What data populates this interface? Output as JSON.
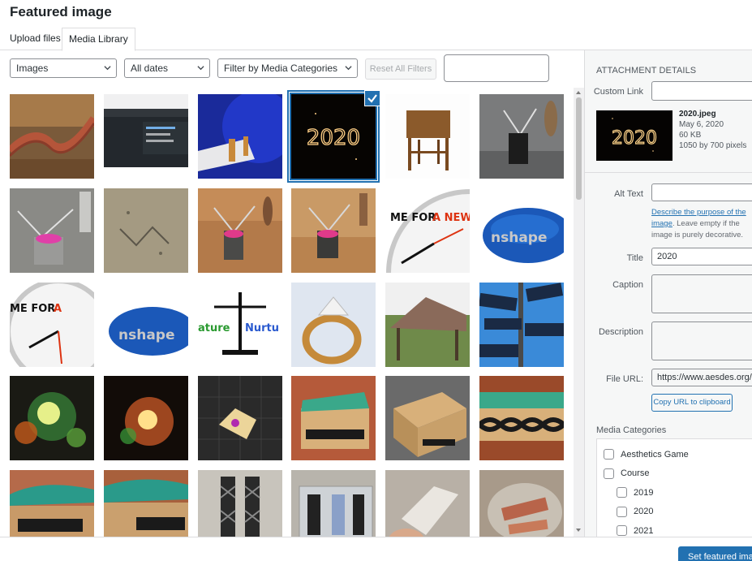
{
  "modal": {
    "title": "Featured image"
  },
  "tabs": [
    {
      "label": "Upload files"
    },
    {
      "label": "Media Library"
    }
  ],
  "filters": {
    "type_selected": "Images",
    "date_selected": "All dates",
    "category_selected": "Filter by Media Categories",
    "reset_label": "Reset All Filters",
    "search_value": ""
  },
  "grid": {
    "selected_index": 3,
    "items": [
      {
        "subject": "brick-serpentine-wall"
      },
      {
        "subject": "admin-screenshot"
      },
      {
        "subject": "spinning-top-blue"
      },
      {
        "subject": "2020-sparkler"
      },
      {
        "subject": "wooden-side-table"
      },
      {
        "subject": "metal-figure-gray"
      },
      {
        "subject": "metal-figure-pink"
      },
      {
        "subject": "metal-figure-carpet"
      },
      {
        "subject": "metal-figure-wood-1"
      },
      {
        "subject": "metal-figure-wood-2"
      },
      {
        "subject": "new-plan-clock-1"
      },
      {
        "subject": "onshape-logo-1"
      },
      {
        "subject": "new-plan-clock-2"
      },
      {
        "subject": "onshape-logo-2"
      },
      {
        "subject": "nature-nurture-scale"
      },
      {
        "subject": "gold-ring"
      },
      {
        "subject": "wooden-pavilion"
      },
      {
        "subject": "advice-signpost"
      },
      {
        "subject": "glowing-lamp-1"
      },
      {
        "subject": "glowing-lamp-2"
      },
      {
        "subject": "figure-on-mat"
      },
      {
        "subject": "celtic-box-1"
      },
      {
        "subject": "wooden-box-open"
      },
      {
        "subject": "celtic-box-2"
      },
      {
        "subject": "celtic-box-3"
      },
      {
        "subject": "celtic-box-4"
      },
      {
        "subject": "celtic-knot-strips"
      },
      {
        "subject": "celtic-knot-container"
      },
      {
        "subject": "celtic-knot-hand"
      },
      {
        "subject": "celtic-knot-dish"
      }
    ]
  },
  "details": {
    "heading": "ATTACHMENT DETAILS",
    "custom_link_label": "Custom Link",
    "custom_link_value": "",
    "filename": "2020.jpeg",
    "date": "May 6, 2020",
    "size": "60 KB",
    "dimensions": "1050 by 700 pixels",
    "preview_text": "2020",
    "alt_label": "Alt Text",
    "alt_value": "",
    "alt_help_link": "Describe the purpose of the image",
    "alt_help_text": ". Leave empty if the image is purely decorative.",
    "title_label": "Title",
    "title_value": "2020",
    "caption_label": "Caption",
    "caption_value": "",
    "description_label": "Description",
    "description_value": "",
    "url_label": "File URL:",
    "url_value": "https://www.aesdes.org/v",
    "copy_label": "Copy URL to clipboard",
    "categories_label": "Media Categories",
    "categories": [
      {
        "label": "Aesthetics Game",
        "level": 0
      },
      {
        "label": "Course",
        "level": 0
      },
      {
        "label": "2019",
        "level": 1
      },
      {
        "label": "2020",
        "level": 1
      },
      {
        "label": "2021",
        "level": 1
      }
    ]
  },
  "footer": {
    "primary_label": "Set featured image"
  },
  "colors": {
    "accent": "#2271b1",
    "sidebar_bg": "#f6f7f7"
  }
}
